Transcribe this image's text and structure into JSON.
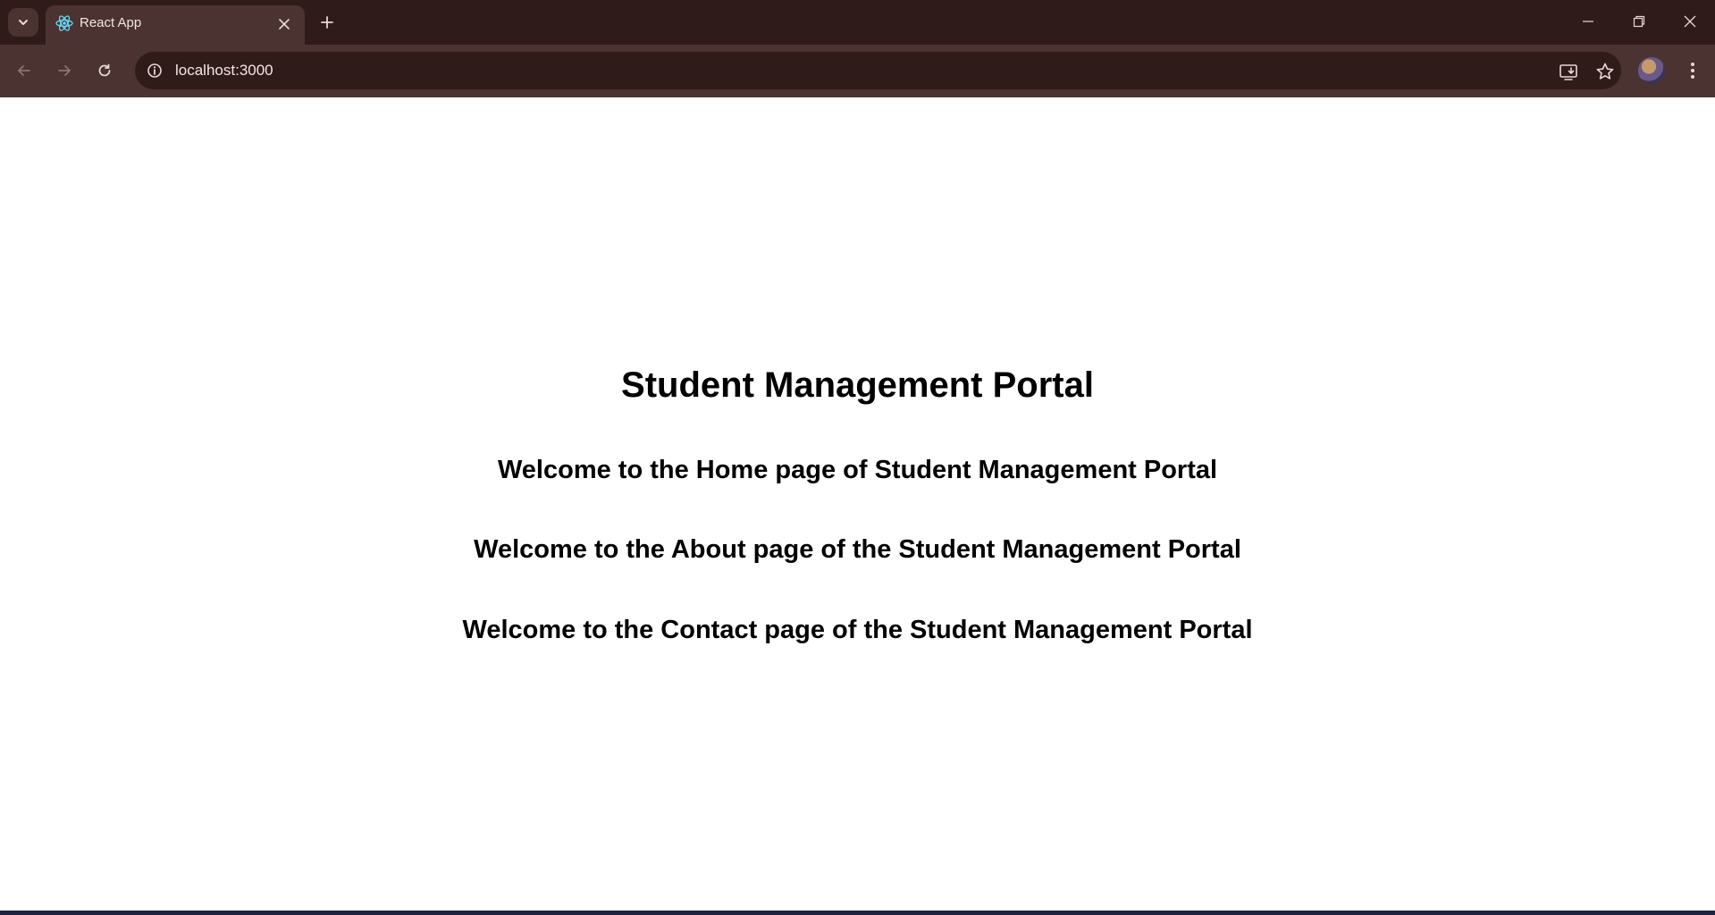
{
  "browser": {
    "tab": {
      "title": "React App",
      "favicon": "react-logo-icon"
    },
    "address_bar": {
      "url": "localhost:3000"
    },
    "icons": {
      "tab_search": "chevron-down-icon",
      "tab_close": "close-icon",
      "new_tab": "plus-icon",
      "minimize": "minimize-icon",
      "restore": "restore-icon",
      "close_window": "close-icon",
      "back": "arrow-left-icon",
      "forward": "arrow-right-icon",
      "reload": "reload-icon",
      "site_info": "info-icon",
      "install_app": "install-icon",
      "bookmark": "star-icon",
      "profile": "avatar",
      "menu": "kebab-menu-icon"
    },
    "colors": {
      "tabstrip": "#2f1b1a",
      "toolbar": "#4a3331",
      "omnibox": "#2f1b1a",
      "icon": "#e8d8d6"
    }
  },
  "page": {
    "title": "Student Management Portal",
    "home_text": "Welcome to the Home page of Student Management Portal",
    "about_text": "Welcome to the About page of the Student Management Portal",
    "contact_text": "Welcome to the Contact page of the Student Management Portal"
  }
}
